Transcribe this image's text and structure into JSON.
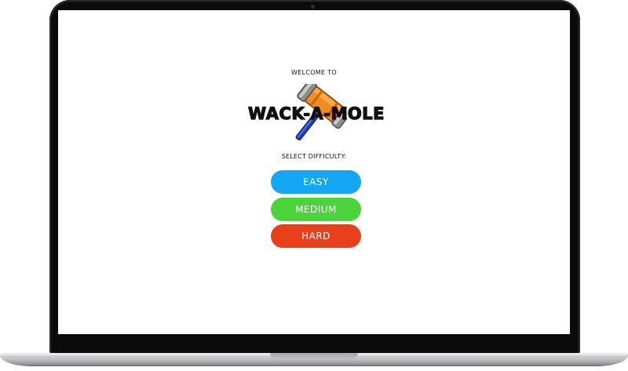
{
  "screen": {
    "welcome_text": "WELCOME TO",
    "logo_text": "WACK-A-MOLE",
    "select_label": "SELECT DIFFICULTY:"
  },
  "difficulty_buttons": [
    {
      "label": "EASY",
      "color": "#14a6f5"
    },
    {
      "label": "MEDIUM",
      "color": "#4cd43d"
    },
    {
      "label": "HARD",
      "color": "#e8401a"
    }
  ],
  "logo_icon": "hammer-icon"
}
